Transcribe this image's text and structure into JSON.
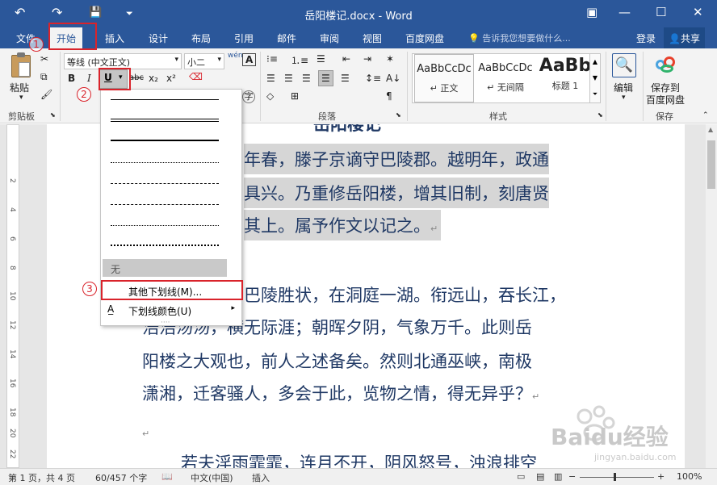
{
  "window": {
    "title": "岳阳楼记.docx - Word",
    "qa_undo": "↶",
    "qa_redo": "↷",
    "qa_save": "💾",
    "qa_more": "⏷",
    "btn_ribbon_opts": "▣",
    "btn_min": "—",
    "btn_max": "☐",
    "btn_close": "✕"
  },
  "tabs": [
    "文件",
    "开始",
    "插入",
    "设计",
    "布局",
    "引用",
    "邮件",
    "审阅",
    "视图",
    "百度网盘"
  ],
  "tell_me": "告诉我您想要做什么...",
  "login": "登录",
  "share": "共享",
  "ribbon": {
    "clipboard": {
      "paste": "粘贴",
      "label": "剪贴板"
    },
    "font": {
      "name": "等线 (中文正文)",
      "size": "小二",
      "wen": "wén",
      "A": "A",
      "bold": "B",
      "italic": "I",
      "underline": "U",
      "strike": "abc",
      "sub": "x₂",
      "sup": "x²",
      "zi": "字"
    },
    "paragraph": {
      "label": "段落"
    },
    "styles": {
      "label": "样式",
      "items": [
        {
          "sample": "AaBbCcDc",
          "name": "↵ 正文"
        },
        {
          "sample": "AaBbCcDc",
          "name": "↵ 无间隔"
        },
        {
          "sample": "AaBb",
          "name": "标题 1"
        }
      ]
    },
    "editing": {
      "label": "编辑"
    },
    "save": {
      "label1": "保存到",
      "label2": "百度网盘",
      "group": "保存"
    }
  },
  "document": {
    "title_partial": "岳阳楼记",
    "lines": [
      {
        "text": "年春，滕子京谪守巴陵郡。越明年，政通",
        "highlight": true
      },
      {
        "text": "具兴。乃重修岳阳楼，增其旧制，刻唐贤",
        "highlight": true
      },
      {
        "text": "其上。属予作文以记之。",
        "highlight": true,
        "mark": "↵"
      },
      {
        "text": "巴陵胜状，在洞庭一湖。衔远山，吞长江，",
        "highlight": false
      },
      {
        "text": "浩浩汤汤，横无际涯；朝晖夕阴，气象万千。此则岳",
        "highlight": false
      },
      {
        "text": "阳楼之大观也，前人之述备矣。然则北通巫峡，南极",
        "highlight": false
      },
      {
        "text": "潇湘，迁客骚人，多会于此，览物之情，得无异乎？",
        "highlight": false,
        "mark": "↵"
      },
      {
        "text": "",
        "highlight": false,
        "mark": "↵"
      },
      {
        "text": "若夫淫雨霏霏，连月不开，阴风怒号，浊浪排空",
        "highlight": false
      }
    ]
  },
  "ruler_numbers": [
    "2",
    "4",
    "6",
    "8",
    "10",
    "12",
    "14",
    "16",
    "18",
    "20",
    "22"
  ],
  "underline_menu": {
    "none": "无",
    "more": "其他下划线(M)...",
    "color": "下划线颜色(U)"
  },
  "annotations": [
    "1",
    "2",
    "3"
  ],
  "statusbar": {
    "page": "第 1 页，共 4 页",
    "words": "60/457 个字",
    "lang": "中文(中国)",
    "mode": "插入",
    "zoom": "100%"
  },
  "watermark": {
    "brand": "Baidu经验",
    "url": "jingyan.baidu.com"
  },
  "colors": {
    "accent": "#2b579a",
    "annotation": "#d9232b",
    "doc_text": "#1f3864"
  }
}
